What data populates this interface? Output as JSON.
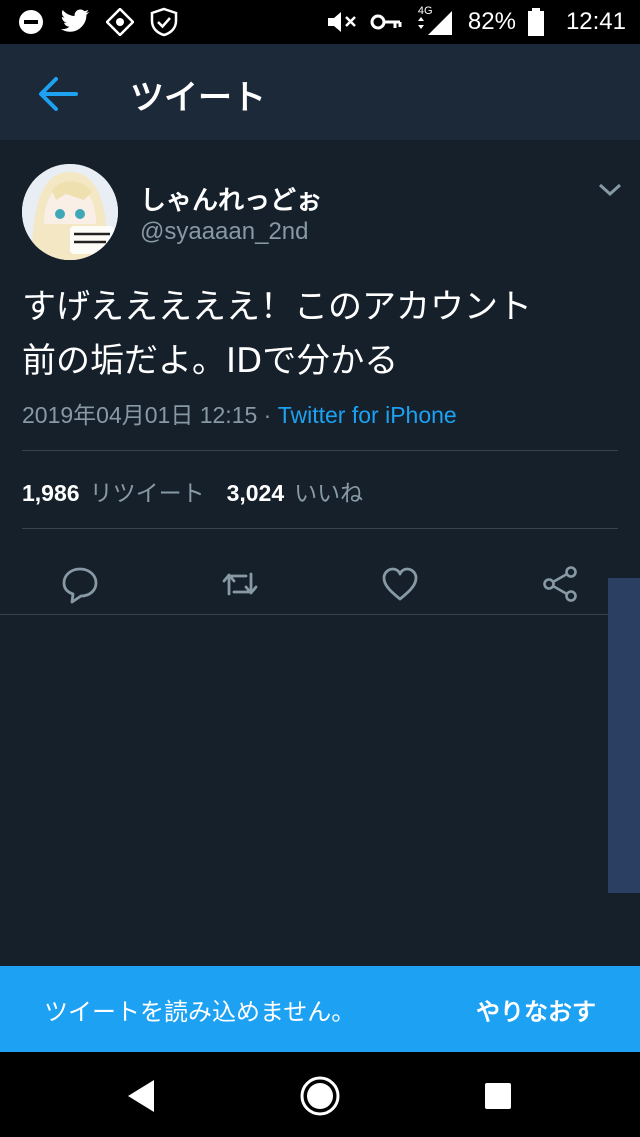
{
  "status_bar": {
    "battery": "82%",
    "time": "12:41",
    "network": "4G",
    "icons": [
      "dnd-icon",
      "twitter-icon",
      "app-icon",
      "shield-check-icon",
      "mute-icon",
      "vpn-key-icon",
      "signal-icon",
      "battery-icon"
    ]
  },
  "header": {
    "title": "ツイート"
  },
  "tweet": {
    "display_name": "しゃんれっどぉ",
    "handle": "@syaaaan_2nd",
    "text_line1": "すげえええええ！このアカウント",
    "text_line2": "前の垢だよ。IDで分かる",
    "date": "2019年04月01日 12:15",
    "separator": " · ",
    "source": "Twitter for iPhone",
    "retweets_count": "1,986",
    "retweets_label": "リツイート",
    "likes_count": "3,024",
    "likes_label": "いいね",
    "avatar_text": "愛の塩 パーチ!!"
  },
  "toast": {
    "message": "ツイートを読み込めません。",
    "retry_label": "やりなおす"
  },
  "colors": {
    "background": "#15202b",
    "appbar": "#1c2938",
    "accent": "#1da1f2",
    "muted": "#8899a6"
  }
}
